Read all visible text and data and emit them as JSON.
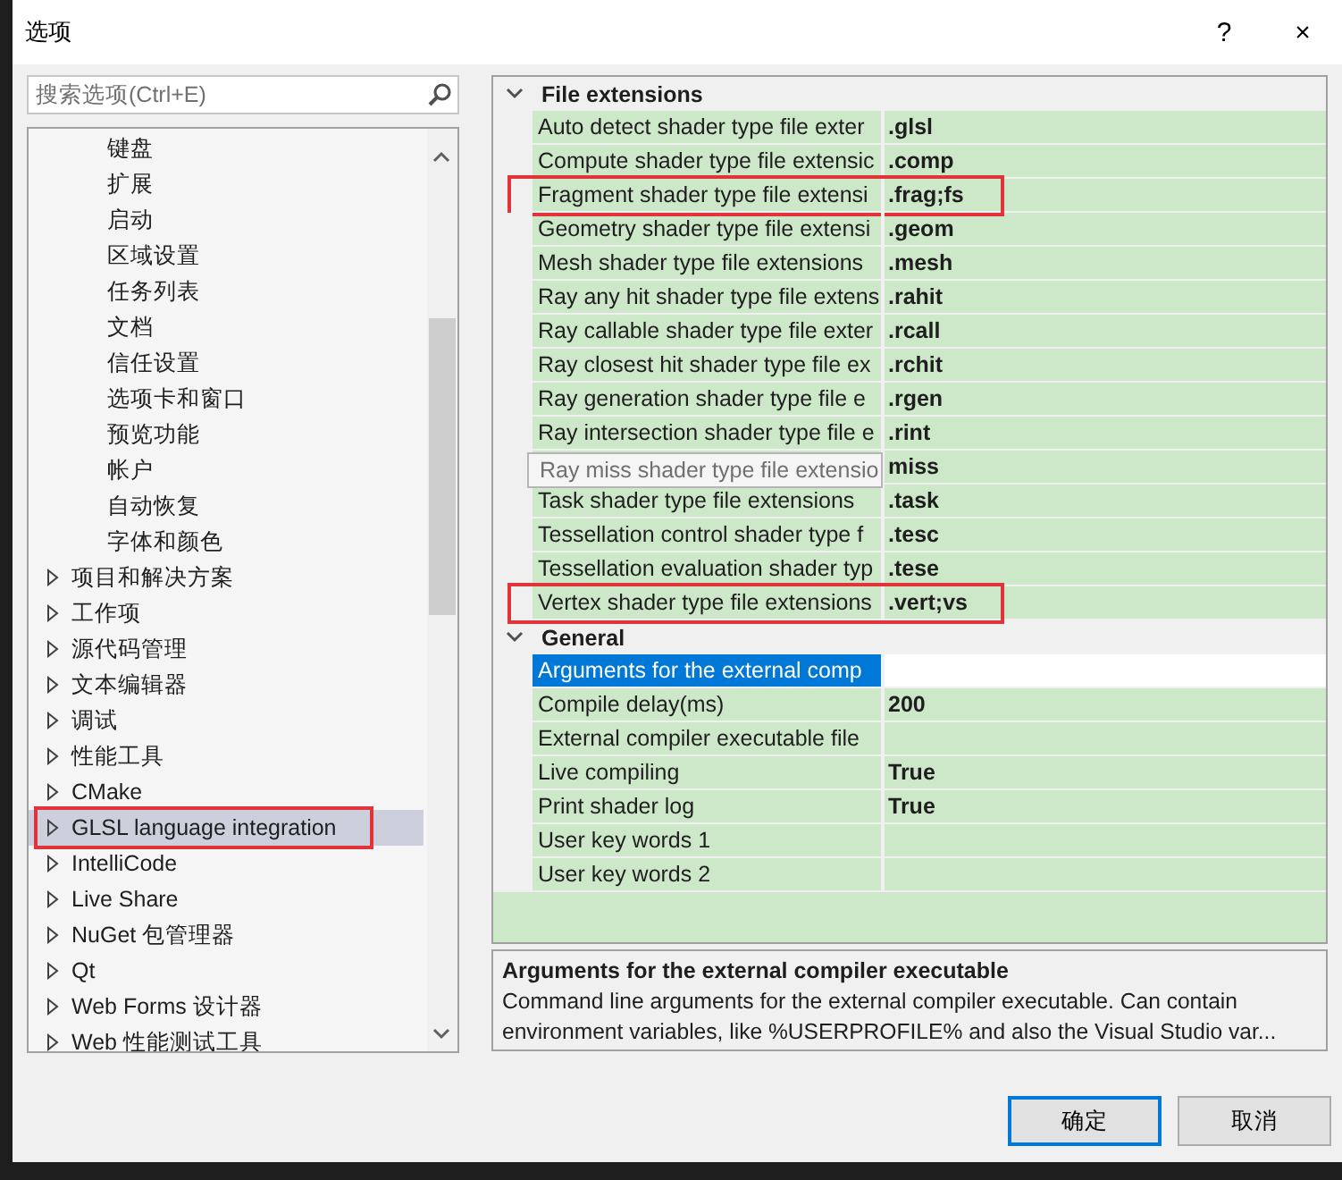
{
  "window": {
    "title": "选项",
    "help": "?",
    "close": "×"
  },
  "search": {
    "placeholder": "搜索选项(Ctrl+E)"
  },
  "tree": {
    "continued_children": [
      {
        "label": "键盘",
        "selected": false
      },
      {
        "label": "扩展",
        "selected": false
      },
      {
        "label": "启动",
        "selected": false
      },
      {
        "label": "区域设置",
        "selected": false
      },
      {
        "label": "任务列表",
        "selected": false
      },
      {
        "label": "文档",
        "selected": false
      },
      {
        "label": "信任设置",
        "selected": false
      },
      {
        "label": "选项卡和窗口",
        "selected": false
      },
      {
        "label": "预览功能",
        "selected": false
      },
      {
        "label": "帐户",
        "selected": false
      },
      {
        "label": "自动恢复",
        "selected": false
      },
      {
        "label": "字体和颜色",
        "selected": false
      }
    ],
    "items": [
      {
        "label": "项目和解决方案",
        "expanded": false,
        "selected": false,
        "highlighted": false
      },
      {
        "label": "工作项",
        "expanded": false,
        "selected": false,
        "highlighted": false
      },
      {
        "label": "源代码管理",
        "expanded": false,
        "selected": false,
        "highlighted": false
      },
      {
        "label": "文本编辑器",
        "expanded": false,
        "selected": false,
        "highlighted": false
      },
      {
        "label": "调试",
        "expanded": false,
        "selected": false,
        "highlighted": false
      },
      {
        "label": "性能工具",
        "expanded": false,
        "selected": false,
        "highlighted": false
      },
      {
        "label": "CMake",
        "expanded": false,
        "selected": false,
        "highlighted": false
      },
      {
        "label": "GLSL language integration",
        "expanded": false,
        "selected": true,
        "highlighted": true
      },
      {
        "label": "IntelliCode",
        "expanded": false,
        "selected": false,
        "highlighted": false
      },
      {
        "label": "Live Share",
        "expanded": false,
        "selected": false,
        "highlighted": false
      },
      {
        "label": "NuGet 包管理器",
        "expanded": false,
        "selected": false,
        "highlighted": false
      },
      {
        "label": "Qt",
        "expanded": false,
        "selected": false,
        "highlighted": false
      },
      {
        "label": "Web Forms 设计器",
        "expanded": false,
        "selected": false,
        "highlighted": false
      },
      {
        "label": "Web 性能测试工具",
        "expanded": false,
        "selected": false,
        "highlighted": false
      }
    ]
  },
  "property_grid": {
    "categories": [
      {
        "name": "File extensions",
        "expanded": true,
        "rows": [
          {
            "label": "Auto detect shader type file exter",
            "value": ".glsl",
            "selected": false,
            "highlighted": false
          },
          {
            "label": "Compute shader type file extensic",
            "value": ".comp",
            "selected": false,
            "highlighted": false
          },
          {
            "label": "Fragment shader type file extensi",
            "value": ".frag;fs",
            "selected": false,
            "highlighted": true
          },
          {
            "label": "Geometry shader type file extensi",
            "value": ".geom",
            "selected": false,
            "highlighted": false
          },
          {
            "label": "Mesh shader type file extensions",
            "value": ".mesh",
            "selected": false,
            "highlighted": false
          },
          {
            "label": "Ray any hit shader type file extens",
            "value": ".rahit",
            "selected": false,
            "highlighted": false
          },
          {
            "label": "Ray callable shader type file exter",
            "value": ".rcall",
            "selected": false,
            "highlighted": false
          },
          {
            "label": "Ray closest hit shader type file ex",
            "value": ".rchit",
            "selected": false,
            "highlighted": false
          },
          {
            "label": "Ray generation shader type file e",
            "value": ".rgen",
            "selected": false,
            "highlighted": false
          },
          {
            "label": "Ray intersection shader type file e",
            "value": ".rint",
            "selected": false,
            "highlighted": false
          },
          {
            "tooltip": "Ray miss shader type file extensio",
            "value": "miss",
            "selected": false,
            "highlighted": false
          },
          {
            "label": "Task shader type file extensions",
            "value": ".task",
            "selected": false,
            "highlighted": false
          },
          {
            "label": "Tessellation control shader type f",
            "value": ".tesc",
            "selected": false,
            "highlighted": false
          },
          {
            "label": "Tessellation evaluation shader typ",
            "value": ".tese",
            "selected": false,
            "highlighted": false
          },
          {
            "label": "Vertex shader type file extensions",
            "value": ".vert;vs",
            "selected": false,
            "highlighted": true
          }
        ]
      },
      {
        "name": "General",
        "expanded": true,
        "rows": [
          {
            "label": "Arguments for the external comp",
            "selected": true,
            "highlighted": false
          },
          {
            "label": "Compile delay(ms)",
            "value": "200",
            "selected": false,
            "highlighted": false
          },
          {
            "label": "External compiler executable file",
            "selected": false,
            "highlighted": false
          },
          {
            "label": "Live compiling",
            "value": "True",
            "selected": false,
            "highlighted": false
          },
          {
            "label": "Print shader log",
            "value": "True",
            "selected": false,
            "highlighted": false
          },
          {
            "label": "User key words 1",
            "selected": false,
            "highlighted": false
          },
          {
            "label": "User key words 2",
            "selected": false,
            "highlighted": false
          }
        ]
      }
    ]
  },
  "description": {
    "title": "Arguments for the external compiler executable",
    "text": "Command line arguments for the external compiler executable. Can contain environment variables, like %USERPROFILE% and also the Visual Studio var..."
  },
  "buttons": [
    {
      "label": "确定",
      "default": true
    },
    {
      "label": "取消",
      "default": false
    }
  ]
}
